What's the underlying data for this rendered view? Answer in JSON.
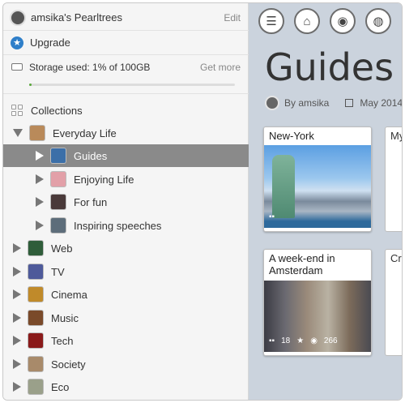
{
  "header": {
    "title": "amsika's Pearltrees",
    "edit_label": "Edit"
  },
  "upgrade": {
    "label": "Upgrade"
  },
  "storage": {
    "label": "Storage used: 1% of 100GB",
    "more_label": "Get more",
    "progress_fraction": 0.01
  },
  "collections": {
    "label": "Collections",
    "items": [
      {
        "label": "Everyday Life",
        "expanded": true,
        "children": [
          {
            "label": "Guides",
            "selected": true
          },
          {
            "label": "Enjoying Life"
          },
          {
            "label": "For fun"
          },
          {
            "label": "Inspiring speeches"
          }
        ]
      },
      {
        "label": "Web"
      },
      {
        "label": "TV"
      },
      {
        "label": "Cinema"
      },
      {
        "label": "Music"
      },
      {
        "label": "Tech"
      },
      {
        "label": "Society"
      },
      {
        "label": "Eco"
      }
    ]
  },
  "nav": {
    "icons": [
      "menu-icon",
      "home-icon",
      "broadcast-icon",
      "globe-icon"
    ]
  },
  "main": {
    "title": "Guides",
    "author": "By amsika",
    "date": "May 2014",
    "cards": [
      {
        "title": "New-York"
      },
      {
        "title": "A week-end in Amsterdam",
        "stats": {
          "pearls": "18",
          "views": "266"
        }
      }
    ],
    "partial_cards": [
      {
        "title": "My"
      },
      {
        "title": "Cr"
      }
    ]
  }
}
